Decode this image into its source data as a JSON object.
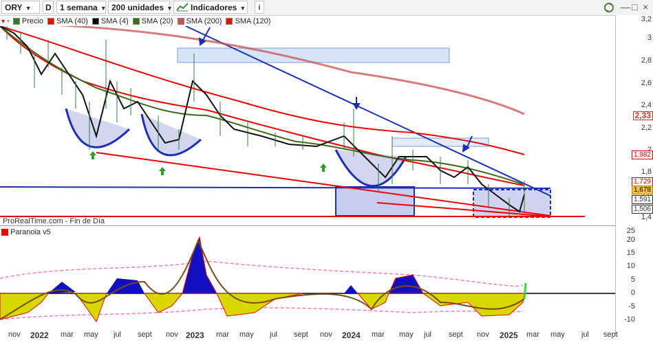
{
  "toolbar": {
    "symbol": "ORY",
    "period_key": "D",
    "interval": "1 semana",
    "units": "200 unidades",
    "indicators": "Indicadores",
    "info_icon": "info-icon",
    "refresh_icon": "refresh-icon",
    "minimize": "—",
    "maximize": "□",
    "close": "×"
  },
  "legend": [
    {
      "label": "Precio",
      "color": "#2e7d32"
    },
    {
      "label": "SMA (40)",
      "color": "#ff0000"
    },
    {
      "label": "SMA (4)",
      "color": "#000000"
    },
    {
      "label": "SMA (20)",
      "color": "#3a6b1a"
    },
    {
      "label": "SMA (200)",
      "color": "#c85050"
    },
    {
      "label": "SMA (120)",
      "color": "#ff0000"
    }
  ],
  "source_note": "ProRealTime.com - Fin de Día",
  "indicator_title": "Paranoia v5",
  "price_axis": [
    "3,2",
    "3",
    "2,8",
    "2,6",
    "2,4",
    "2,2",
    "2",
    "1,8",
    "1,6",
    "1,4"
  ],
  "price_boxes": [
    {
      "value": "2,33",
      "color": "#c83232"
    },
    {
      "value": "1,982",
      "color": "#c80000"
    },
    {
      "value": "1,729",
      "color": "#c80000"
    },
    {
      "value": "1,678",
      "color": "#000000",
      "bg": "#f5c542"
    },
    {
      "value": "1,591",
      "color": "#333333"
    },
    {
      "value": "1,506",
      "color": "#333333"
    }
  ],
  "ind_axis": [
    "25",
    "20",
    "15",
    "10",
    "5",
    "0",
    "-5",
    "-10"
  ],
  "x_axis": [
    {
      "label": "nov",
      "bold": false
    },
    {
      "label": "2022",
      "bold": true
    },
    {
      "label": "mar",
      "bold": false
    },
    {
      "label": "may",
      "bold": false
    },
    {
      "label": "jul",
      "bold": false
    },
    {
      "label": "sept",
      "bold": false
    },
    {
      "label": "nov",
      "bold": false
    },
    {
      "label": "2023",
      "bold": true
    },
    {
      "label": "mar",
      "bold": false
    },
    {
      "label": "may",
      "bold": false
    },
    {
      "label": "jul",
      "bold": false
    },
    {
      "label": "sept",
      "bold": false
    },
    {
      "label": "nov",
      "bold": false
    },
    {
      "label": "2024",
      "bold": true
    },
    {
      "label": "mar",
      "bold": false
    },
    {
      "label": "may",
      "bold": false
    },
    {
      "label": "jul",
      "bold": false
    },
    {
      "label": "sept",
      "bold": false
    },
    {
      "label": "nov",
      "bold": false
    },
    {
      "label": "2025",
      "bold": true
    },
    {
      "label": "mar",
      "bold": false
    },
    {
      "label": "may",
      "bold": false
    },
    {
      "label": "jul",
      "bold": false
    },
    {
      "label": "sept",
      "bold": false
    }
  ]
}
